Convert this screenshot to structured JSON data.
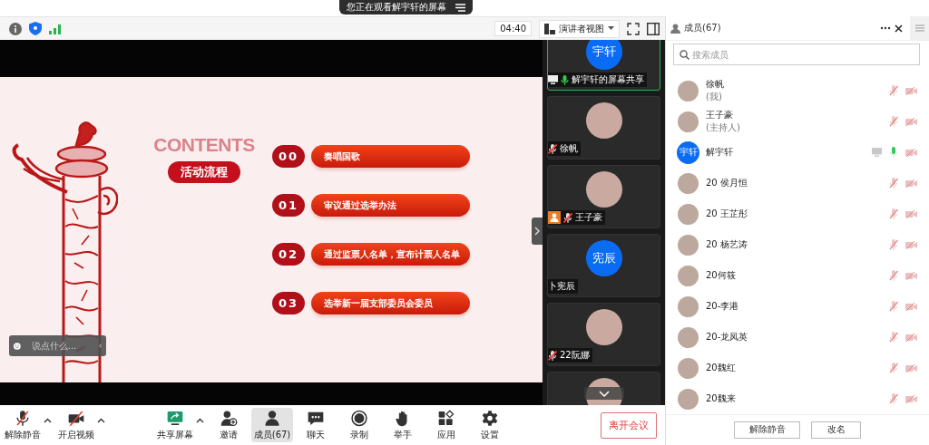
{
  "banner": {
    "text": "您正在观看解宇轩的屏幕"
  },
  "toolbar": {
    "timer": "04:40",
    "view_selector": "演讲者视图"
  },
  "slide": {
    "heading": "CONTENTS",
    "section_label": "活动流程",
    "items": [
      {
        "number": "00",
        "title": "奏唱国歌"
      },
      {
        "number": "01",
        "title": "审议通过选举办法"
      },
      {
        "number": "02",
        "title": "通过监票人名单，宣布计票人名单"
      },
      {
        "number": "03",
        "title": "选举新一届支部委员会委员"
      }
    ]
  },
  "chat": {
    "placeholder": "说点什么..."
  },
  "video_tiles": [
    {
      "name": "解宇轩的屏幕共享",
      "avatar_text": "宇轩",
      "has_audio": true,
      "muted": false,
      "sharing": true,
      "host": false,
      "active": true
    },
    {
      "name": "徐帆",
      "has_audio": true,
      "muted": true,
      "sharing": false,
      "host": false,
      "active": false
    },
    {
      "name": "王子豪",
      "has_audio": true,
      "muted": true,
      "sharing": false,
      "host": true,
      "active": false
    },
    {
      "name": "卜宪辰",
      "avatar_text": "宪辰",
      "has_audio": false,
      "sharing": false,
      "host": false,
      "active": false
    },
    {
      "name": "22阮娜",
      "has_audio": true,
      "muted": true,
      "sharing": false,
      "host": false,
      "active": false
    }
  ],
  "bottom_toolbar": [
    {
      "label": "解除静音",
      "kind": "mic_off",
      "selected": false,
      "caret": true
    },
    {
      "label": "开启视频",
      "kind": "camera_off",
      "selected": false,
      "caret": true
    },
    {
      "label": "共享屏幕",
      "kind": "share",
      "selected": false,
      "caret": true
    },
    {
      "label": "邀请",
      "kind": "invite",
      "selected": false,
      "caret": false
    },
    {
      "label": "成员(67)",
      "kind": "members",
      "selected": true,
      "caret": false
    },
    {
      "label": "聊天",
      "kind": "chat",
      "selected": false,
      "caret": false
    },
    {
      "label": "录制",
      "kind": "record",
      "selected": false,
      "caret": false
    },
    {
      "label": "举手",
      "kind": "hand",
      "selected": false,
      "caret": false
    },
    {
      "label": "应用",
      "kind": "apps",
      "selected": false,
      "caret": false
    },
    {
      "label": "设置",
      "kind": "settings",
      "selected": false,
      "caret": false
    }
  ],
  "leave_button": "离开会议",
  "members_panel": {
    "title": "成员(67)",
    "search": {
      "placeholder": "搜索成员"
    },
    "members": [
      {
        "name": "徐帆",
        "sub": "(我)",
        "muted": true,
        "sharing": false
      },
      {
        "name": "王子豪",
        "sub": "(主持人)",
        "muted": true,
        "sharing": false
      },
      {
        "name": "解宇轩",
        "avatar_text": "宇轩",
        "muted": false,
        "sharing": true
      },
      {
        "name": "20 侯月恒",
        "muted": true,
        "sharing": false
      },
      {
        "name": "20 王芷彤",
        "muted": true,
        "sharing": false
      },
      {
        "name": "20 杨艺涛",
        "muted": true,
        "sharing": false
      },
      {
        "name": "20何筱",
        "muted": true,
        "sharing": false
      },
      {
        "name": "20-李港",
        "muted": true,
        "sharing": false
      },
      {
        "name": "20-龙凤英",
        "muted": true,
        "sharing": false
      },
      {
        "name": "20魏红",
        "muted": true,
        "sharing": false
      },
      {
        "name": "20魏来",
        "muted": true,
        "sharing": false
      }
    ],
    "buttons": [
      "解除静音",
      "改名"
    ]
  }
}
